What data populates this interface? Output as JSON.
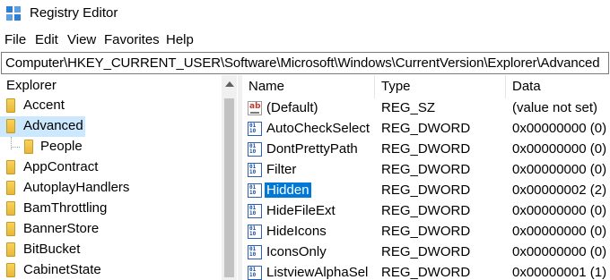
{
  "window": {
    "title": "Registry Editor",
    "icon": "registry-editor-icon"
  },
  "menu": [
    "File",
    "Edit",
    "View",
    "Favorites",
    "Help"
  ],
  "address": "Computer\\HKEY_CURRENT_USER\\Software\\Microsoft\\Windows\\CurrentVersion\\Explorer\\Advanced",
  "tree": {
    "root_label": "Explorer",
    "items": [
      {
        "label": "Accent",
        "indent": 0,
        "selected": false
      },
      {
        "label": "Advanced",
        "indent": 0,
        "selected": true
      },
      {
        "label": "People",
        "indent": 1,
        "selected": false
      },
      {
        "label": "AppContract",
        "indent": 0,
        "selected": false
      },
      {
        "label": "AutoplayHandlers",
        "indent": 0,
        "selected": false
      },
      {
        "label": "BamThrottling",
        "indent": 0,
        "selected": false
      },
      {
        "label": "BannerStore",
        "indent": 0,
        "selected": false
      },
      {
        "label": "BitBucket",
        "indent": 0,
        "selected": false
      },
      {
        "label": "CabinetState",
        "indent": 0,
        "selected": false
      }
    ]
  },
  "list": {
    "columns": [
      "Name",
      "Type",
      "Data"
    ],
    "rows": [
      {
        "name": "(Default)",
        "type": "REG_SZ",
        "data": "(value not set)",
        "icon": "reg-sz-icon",
        "selected": false
      },
      {
        "name": "AutoCheckSelect",
        "type": "REG_DWORD",
        "data": "0x00000000 (0)",
        "icon": "reg-dword-icon",
        "selected": false
      },
      {
        "name": "DontPrettyPath",
        "type": "REG_DWORD",
        "data": "0x00000000 (0)",
        "icon": "reg-dword-icon",
        "selected": false
      },
      {
        "name": "Filter",
        "type": "REG_DWORD",
        "data": "0x00000000 (0)",
        "icon": "reg-dword-icon",
        "selected": false
      },
      {
        "name": "Hidden",
        "type": "REG_DWORD",
        "data": "0x00000002 (2)",
        "icon": "reg-dword-icon",
        "selected": true
      },
      {
        "name": "HideFileExt",
        "type": "REG_DWORD",
        "data": "0x00000000 (0)",
        "icon": "reg-dword-icon",
        "selected": false
      },
      {
        "name": "HideIcons",
        "type": "REG_DWORD",
        "data": "0x00000000 (0)",
        "icon": "reg-dword-icon",
        "selected": false
      },
      {
        "name": "IconsOnly",
        "type": "REG_DWORD",
        "data": "0x00000000 (0)",
        "icon": "reg-dword-icon",
        "selected": false
      },
      {
        "name": "ListviewAlphaSel",
        "type": "REG_DWORD",
        "data": "0x00000001 (1)",
        "icon": "reg-dword-icon",
        "selected": false
      }
    ]
  },
  "colors": {
    "selection": "#0078d7",
    "tree_selection": "#cce8ff"
  }
}
